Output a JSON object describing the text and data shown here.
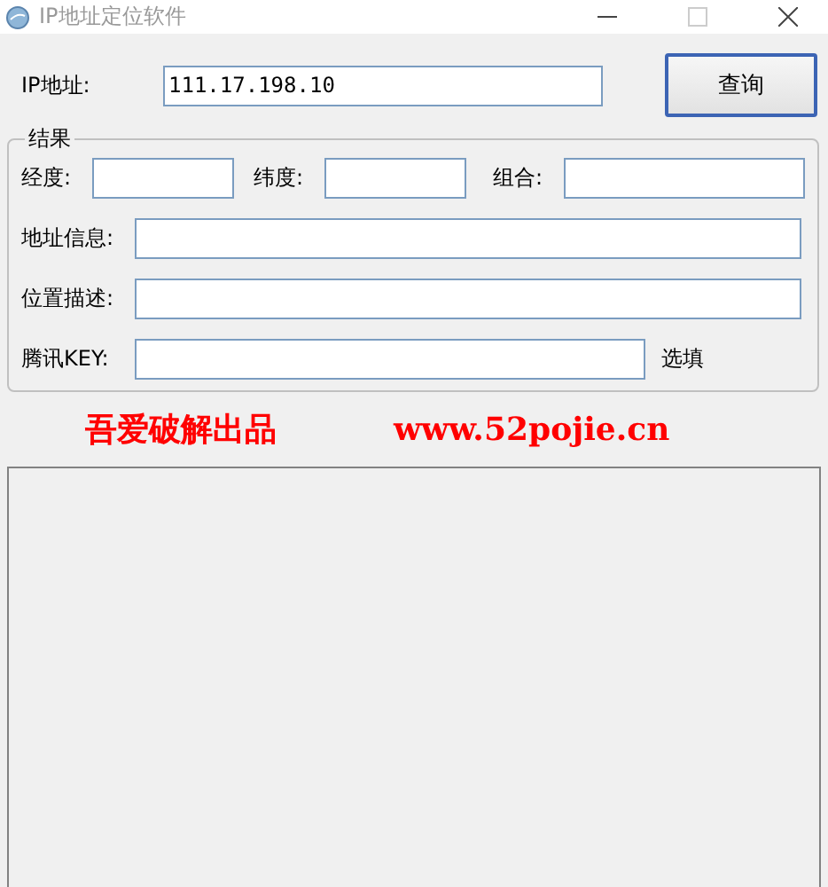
{
  "window": {
    "title": "IP地址定位软件"
  },
  "ip": {
    "label": "IP地址:",
    "value": "111.17.198.10"
  },
  "query_button": "查询",
  "result_group": {
    "legend": "结果",
    "coords": [
      {
        "label": "经度:"
      },
      {
        "label": "纬度:"
      },
      {
        "label": "组合:"
      }
    ],
    "rows": [
      {
        "label": "地址信息:"
      },
      {
        "label": "位置描述:"
      },
      {
        "label": "腾讯KEY:",
        "note": "选填"
      }
    ]
  },
  "banner": {
    "credit": "吾爱破解出品",
    "url": "www.52pojie.cn"
  }
}
